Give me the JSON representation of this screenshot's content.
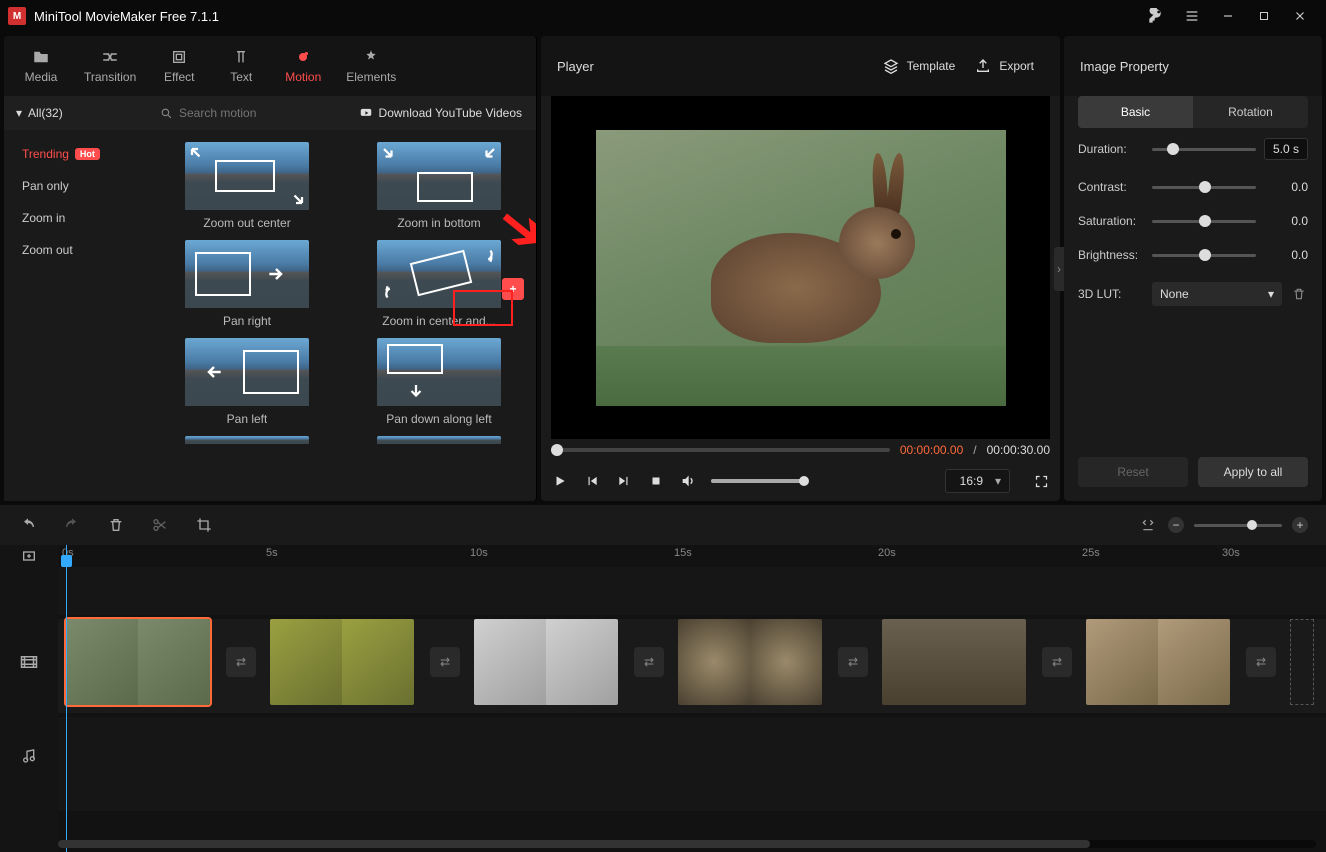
{
  "app": {
    "title": "MiniTool MovieMaker Free 7.1.1"
  },
  "mainTabs": [
    {
      "id": "media",
      "label": "Media"
    },
    {
      "id": "transition",
      "label": "Transition"
    },
    {
      "id": "effect",
      "label": "Effect"
    },
    {
      "id": "text",
      "label": "Text"
    },
    {
      "id": "motion",
      "label": "Motion",
      "active": true
    },
    {
      "id": "elements",
      "label": "Elements"
    }
  ],
  "motionPanel": {
    "allLabel": "All(32)",
    "searchPlaceholder": "Search motion",
    "downloadLabel": "Download YouTube Videos",
    "categories": [
      {
        "label": "Trending",
        "hot": true,
        "active": true
      },
      {
        "label": "Pan only"
      },
      {
        "label": "Zoom in"
      },
      {
        "label": "Zoom out"
      }
    ],
    "items": [
      {
        "label": "Zoom out center"
      },
      {
        "label": "Zoom in bottom"
      },
      {
        "label": "Pan right"
      },
      {
        "label": "Zoom in center and...",
        "highlighted": true
      },
      {
        "label": "Pan left"
      },
      {
        "label": "Pan down along left"
      }
    ],
    "hotBadge": "Hot"
  },
  "player": {
    "title": "Player",
    "template": "Template",
    "export": "Export",
    "timeCurrent": "00:00:00.00",
    "timeTotal": "00:00:30.00",
    "aspect": "16:9"
  },
  "props": {
    "title": "Image Property",
    "tabBasic": "Basic",
    "tabRotation": "Rotation",
    "duration": {
      "label": "Duration:",
      "value": "5.0 s"
    },
    "contrast": {
      "label": "Contrast:",
      "value": "0.0"
    },
    "saturation": {
      "label": "Saturation:",
      "value": "0.0"
    },
    "brightness": {
      "label": "Brightness:",
      "value": "0.0"
    },
    "lut": {
      "label": "3D LUT:",
      "value": "None"
    },
    "reset": "Reset",
    "apply": "Apply to all"
  },
  "timeline": {
    "ticks": [
      "0s",
      "5s",
      "10s",
      "15s",
      "20s",
      "25s",
      "30s"
    ]
  }
}
